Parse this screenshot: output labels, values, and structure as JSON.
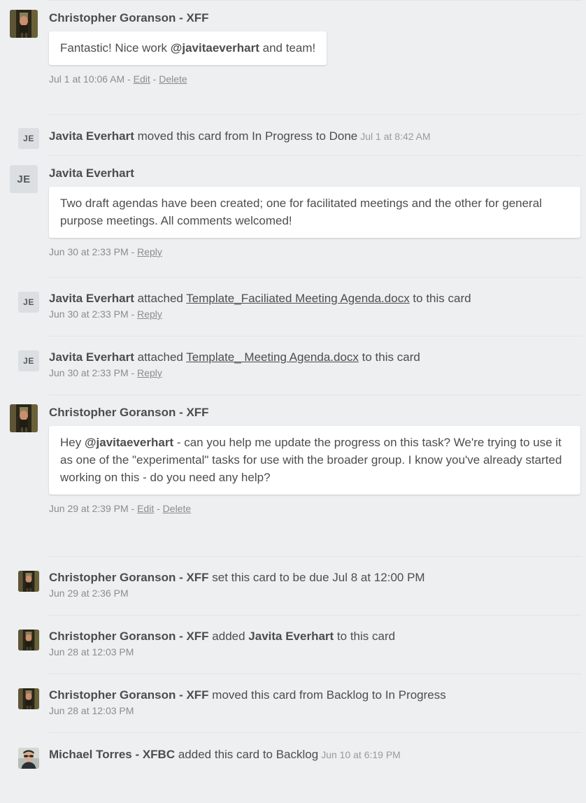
{
  "theme": {
    "background": "#edeff0",
    "separator": "#e2e4e6",
    "bubble_bg": "#ffffff",
    "text": "#4d4d4d",
    "muted_text": "#8c8c8c",
    "initials_avatar_bg": "#dcdfe2"
  },
  "activity": [
    {
      "kind": "comment",
      "avatar": "photo-christopher",
      "avatar_label": "christopher-goranson-avatar",
      "author": "Christopher Goranson - XFF",
      "body_prefix": "Fantastic! Nice work ",
      "body_mention": "@javitaeverhart",
      "body_suffix": " and team!",
      "timestamp": "Jul 1 at 10:06 AM",
      "sep1": "-",
      "action1": "Edit",
      "sep2": "-",
      "action2": "Delete"
    },
    {
      "kind": "action",
      "avatar": "initials-je",
      "avatar_label": "javita-everhart-avatar",
      "initials": "JE",
      "actor": "Javita Everhart",
      "action": " moved this card from In Progress to Done",
      "inline_time": "Jul 1 at 8:42 AM"
    },
    {
      "kind": "comment",
      "avatar": "initials-je",
      "avatar_label": "javita-everhart-avatar",
      "initials": "JE",
      "author": "Javita Everhart",
      "body_plain": "Two draft agendas have been created; one for facilitated meetings and the other for general purpose meetings. All comments welcomed!",
      "timestamp": "Jun 30 at 2:33 PM",
      "sep1": "-",
      "action1": "Reply"
    },
    {
      "kind": "attachment",
      "avatar": "initials-je",
      "avatar_label": "javita-everhart-avatar",
      "initials": "JE",
      "actor": "Javita Everhart",
      "verb": " attached ",
      "attachment": "Template_Faciliated Meeting Agenda.docx",
      "tail": " to this card",
      "timestamp": "Jun 30 at 2:33 PM",
      "sep1": "-",
      "action1": "Reply"
    },
    {
      "kind": "attachment",
      "avatar": "initials-je",
      "avatar_label": "javita-everhart-avatar",
      "initials": "JE",
      "actor": "Javita Everhart",
      "verb": " attached ",
      "attachment": "Template_ Meeting Agenda.docx",
      "tail": " to this card",
      "timestamp": "Jun 30 at 2:33 PM",
      "sep1": "-",
      "action1": "Reply"
    },
    {
      "kind": "comment",
      "avatar": "photo-christopher",
      "avatar_label": "christopher-goranson-avatar",
      "author": "Christopher Goranson - XFF",
      "body_prefix": "Hey ",
      "body_mention": "@javitaeverhart",
      "body_suffix": " - can you help me update the progress on this task? We're trying to use it as one of the \"experimental\" tasks for use with the broader group. I know you've already started working on this - do you need any help?",
      "timestamp": "Jun 29 at 2:39 PM",
      "sep1": "-",
      "action1": "Edit",
      "sep2": "-",
      "action2": "Delete"
    },
    {
      "kind": "action",
      "avatar": "photo-christopher",
      "avatar_label": "christopher-goranson-avatar",
      "actor": "Christopher Goranson - XFF",
      "action": " set this card to be due Jul 8 at 12:00 PM",
      "timestamp": "Jun 29 at 2:36 PM"
    },
    {
      "kind": "action",
      "avatar": "photo-christopher",
      "avatar_label": "christopher-goranson-avatar",
      "actor": "Christopher Goranson - XFF",
      "action": " added ",
      "bold_target": "Javita Everhart",
      "tail": " to this card",
      "timestamp": "Jun 28 at 12:03 PM"
    },
    {
      "kind": "action",
      "avatar": "photo-christopher",
      "avatar_label": "christopher-goranson-avatar",
      "actor": "Christopher Goranson - XFF",
      "action": " moved this card from Backlog to In Progress",
      "timestamp": "Jun 28 at 12:03 PM"
    },
    {
      "kind": "action",
      "avatar": "photo-michael",
      "avatar_label": "michael-torres-avatar",
      "actor": "Michael Torres - XFBC",
      "action": " added this card to Backlog",
      "inline_time": "Jun 10 at 6:19 PM"
    }
  ]
}
